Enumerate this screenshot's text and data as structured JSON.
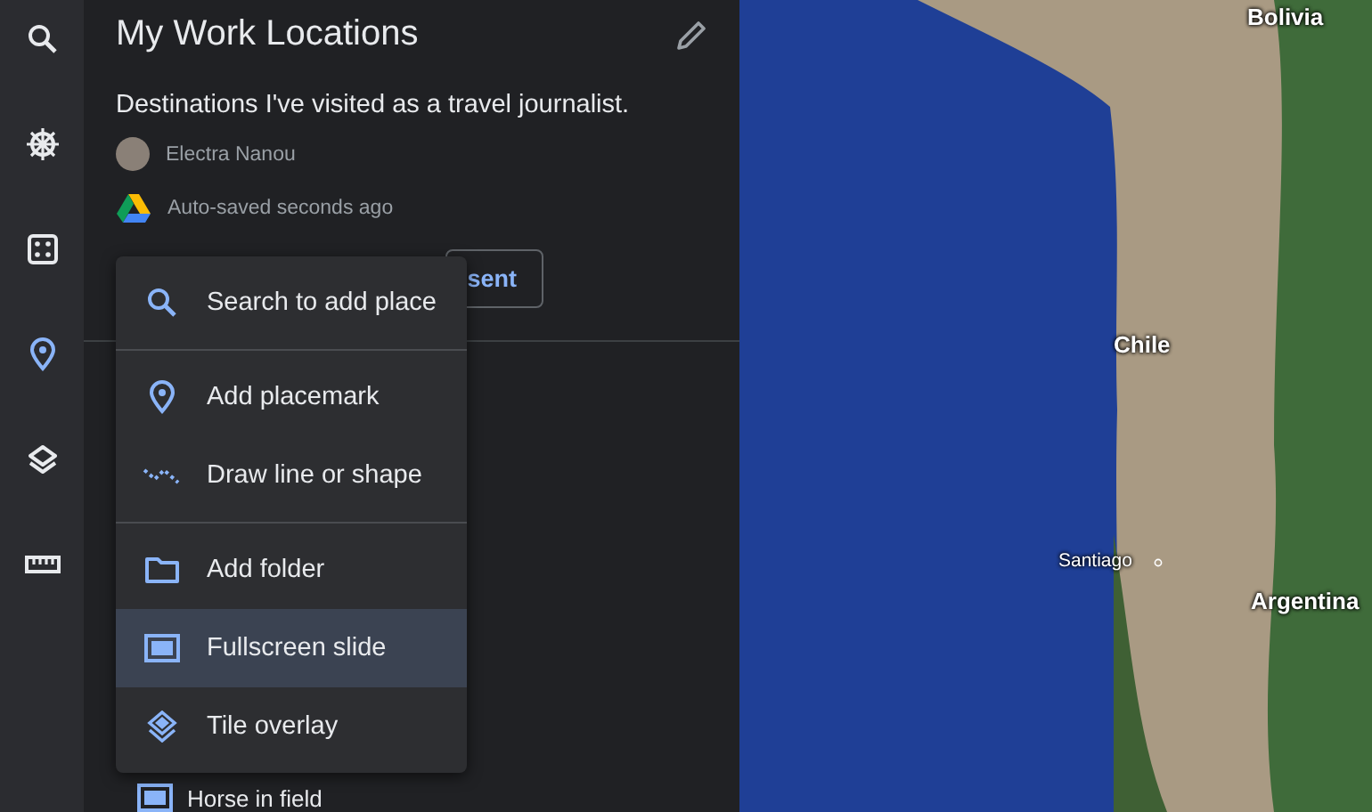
{
  "rail": [
    {
      "kind": "search",
      "selected": false
    },
    {
      "kind": "wheel",
      "selected": false
    },
    {
      "kind": "dice",
      "selected": false
    },
    {
      "kind": "placemark",
      "selected": true
    },
    {
      "kind": "layers",
      "selected": false
    },
    {
      "kind": "ruler",
      "selected": false
    }
  ],
  "project": {
    "title": "My Work Locations",
    "description": "Destinations I've visited as a travel journalist.",
    "author": "Electra Nanou",
    "save_status": "Auto-saved seconds ago",
    "present_button": "sent"
  },
  "menu": {
    "groups": [
      {
        "items": [
          {
            "kind": "search",
            "label": "Search to add place",
            "selected": false
          }
        ]
      },
      {
        "items": [
          {
            "kind": "placemark",
            "label": "Add placemark",
            "selected": false
          },
          {
            "kind": "line",
            "label": "Draw line or shape",
            "selected": false
          }
        ]
      },
      {
        "items": [
          {
            "kind": "folder",
            "label": "Add folder",
            "selected": false
          },
          {
            "kind": "slide",
            "label": "Fullscreen slide",
            "selected": true
          },
          {
            "kind": "tile",
            "label": "Tile overlay",
            "selected": false
          }
        ]
      }
    ]
  },
  "features": [
    {
      "kind": "slide",
      "label": "Horse in field"
    }
  ],
  "map": {
    "labels": [
      {
        "kind": "country",
        "text": "Bolivia"
      },
      {
        "kind": "country",
        "text": "Chile"
      },
      {
        "kind": "city",
        "text": "Santiago"
      },
      {
        "kind": "country",
        "text": "Argentina"
      }
    ]
  }
}
